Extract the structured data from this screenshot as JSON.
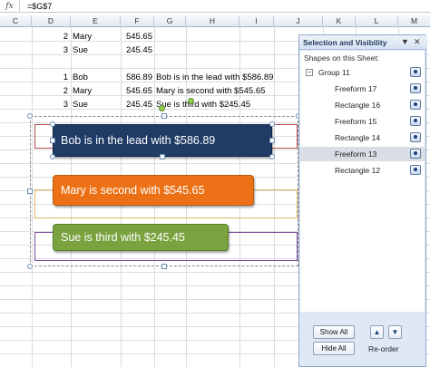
{
  "formula_bar": {
    "fx_label": "fx",
    "formula": "=$G$7"
  },
  "columns": [
    "C",
    "D",
    "E",
    "F",
    "G",
    "H",
    "I",
    "J",
    "K",
    "L",
    "M"
  ],
  "sheet": {
    "rows_top": [
      {
        "num": "2",
        "name": "Mary",
        "value": "545.65"
      },
      {
        "num": "3",
        "name": "Sue",
        "value": "245.45"
      }
    ],
    "rows_sorted": [
      {
        "num": "1",
        "name": "Bob",
        "value": "586.89",
        "text": "Bob is in the lead with $586.89"
      },
      {
        "num": "2",
        "name": "Mary",
        "value": "545.65",
        "text": "Mary is second with $545.65"
      },
      {
        "num": "3",
        "name": "Sue",
        "value": "245.45",
        "text": "Sue is third with $245.45"
      }
    ]
  },
  "shapes": {
    "bob_label": "Bob is in the lead with $586.89",
    "mary_label": "Mary is second with $545.65",
    "sue_label": "Sue is third with $245.45",
    "colors": {
      "bob": "#1f3b66",
      "mary": "#ec7116",
      "sue": "#7aa23f"
    }
  },
  "selection_pane": {
    "title": "Selection and Visibility",
    "dropdown_icon": "chevron-down-icon",
    "close_icon": "close-icon",
    "shapes_label": "Shapes on this Sheet:",
    "group": {
      "name": "Group 11",
      "expander": "−"
    },
    "items": [
      {
        "name": "Freeform 17",
        "selected": false
      },
      {
        "name": "Rectangle 16",
        "selected": false
      },
      {
        "name": "Freeform 15",
        "selected": false
      },
      {
        "name": "Rectangle 14",
        "selected": false
      },
      {
        "name": "Freeform 13",
        "selected": true
      },
      {
        "name": "Rectangle 12",
        "selected": false
      }
    ],
    "show_all": "Show All",
    "hide_all": "Hide All",
    "reorder": "Re-order",
    "up_arrow": "▲",
    "down_arrow": "▼"
  }
}
